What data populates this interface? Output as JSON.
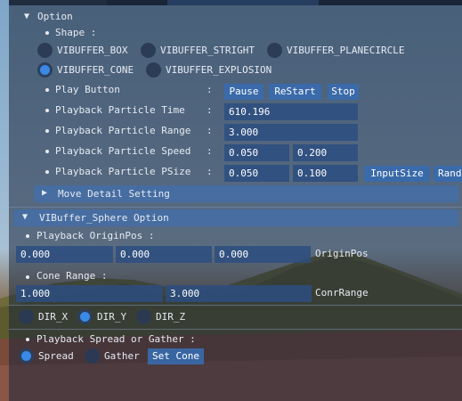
{
  "option_header": "Option",
  "shape_label": "Shape :",
  "shape_options": [
    "VIBUFFER_BOX",
    "VIBUFFER_STRIGHT",
    "VIBUFFER_PLANECIRCLE",
    "VIBUFFER_CONE",
    "VIBUFFER_EXPLOSION"
  ],
  "selected_shape": "VIBUFFER_CONE",
  "play_button": {
    "label": "Play Button",
    "colon": ":",
    "pause": "Pause",
    "restart": "ReStart",
    "stop": "Stop"
  },
  "time": {
    "label": "Playback Particle Time",
    "colon": ":",
    "value": "610.196"
  },
  "range": {
    "label": "Playback Particle Range",
    "colon": ":",
    "value": "3.000"
  },
  "speed": {
    "label": "Playback Particle Speed",
    "colon": ":",
    "v1": "0.050",
    "v2": "0.200"
  },
  "psize": {
    "label": "Playback Particle PSize",
    "colon": ":",
    "v1": "0.050",
    "v2": "0.100",
    "input_size": "InputSize",
    "rand": "Rand"
  },
  "move_detail": "Move Detail Setting",
  "sphere_header": "VIBuffer_Sphere Option",
  "origin": {
    "label": "Playback OriginPos :",
    "x": "0.000",
    "y": "0.000",
    "z": "0.000",
    "name": "OriginPos"
  },
  "cone": {
    "label": "Cone Range :",
    "v1": "1.000",
    "v2": "3.000",
    "name": "ConrRange"
  },
  "dirs": [
    "DIR_X",
    "DIR_Y",
    "DIR_Z"
  ],
  "selected_dir": "DIR_Y",
  "spread_label": "Playback Spread or Gather :",
  "spread_options": [
    "Spread",
    "Gather"
  ],
  "selected_spread": "Spread",
  "set_cone": "Set Cone",
  "colors": {
    "accent": "#3a89e6",
    "header": "#426eaa",
    "field": "#2c4e80",
    "button": "#386aac"
  }
}
